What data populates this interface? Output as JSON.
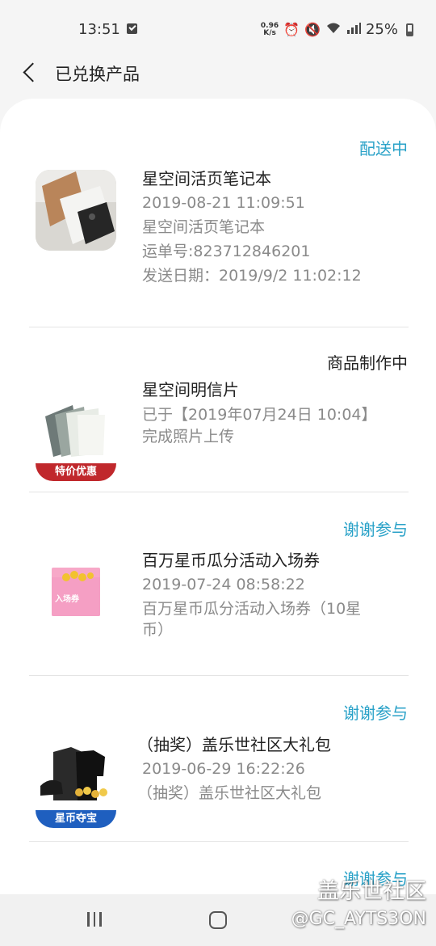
{
  "status_bar": {
    "time": "13:51",
    "net_speed_value": "0.96",
    "net_speed_unit": "K/s",
    "battery": "25%"
  },
  "header": {
    "title": "已兑换产品"
  },
  "orders": [
    {
      "status": "配送中",
      "name": "星空间活页笔记本",
      "date": "2019-08-21 11:09:51",
      "desc": "星空间活页笔记本",
      "tracking": "运单号:823712846201",
      "ship_date": "发送日期：2019/9/2 11:02:12"
    },
    {
      "status": "商品制作中",
      "name": "星空间明信片",
      "line1": "已于【2019年07月24日 10:04】",
      "line2": "完成照片上传",
      "badge": "特价优惠"
    },
    {
      "status": "谢谢参与",
      "name": "百万星币瓜分活动入场券",
      "date": "2019-07-24 08:58:22",
      "desc_line1": "百万星币瓜分活动入场券（10星",
      "desc_line2": "币）",
      "ticket_text": "入场券"
    },
    {
      "status": "谢谢参与",
      "name": "（抽奖）盖乐世社区大礼包",
      "date": "2019-06-29 16:22:26",
      "desc": "（抽奖）盖乐世社区大礼包",
      "badge": "星币夺宝"
    },
    {
      "status": "谢谢参与"
    }
  ],
  "watermark": {
    "line1": "盖乐世社区",
    "line2": "@GC_AYTS3ON"
  },
  "colors": {
    "accent": "#2aa2c8",
    "badge_red": "#c0282c",
    "badge_blue": "#1f5fbf"
  }
}
